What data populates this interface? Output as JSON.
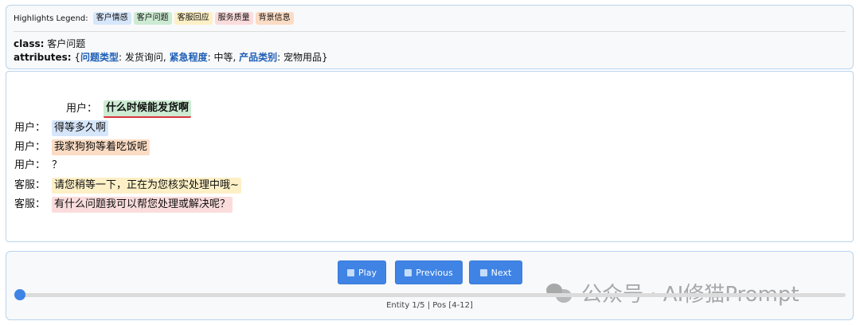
{
  "legend": {
    "title": "Highlights Legend:",
    "tags": [
      {
        "label": "客户情感",
        "color": "#d6e6fa"
      },
      {
        "label": "客户问题",
        "color": "#cdebd3"
      },
      {
        "label": "客服回应",
        "color": "#fdf0c6"
      },
      {
        "label": "服务质量",
        "color": "#fbdcdc"
      },
      {
        "label": "背景信息",
        "color": "#fbdcc4"
      }
    ]
  },
  "meta": {
    "class_key": "class:",
    "class_value": "客户问题",
    "attrs_key": "attributes:",
    "attrs_open": "{",
    "attrs_close": "}",
    "attrs": [
      {
        "key": "问题类型",
        "value": "发货询问"
      },
      {
        "key": "紧急程度",
        "value": "中等"
      },
      {
        "key": "产品类别",
        "value": "宠物用品"
      }
    ]
  },
  "dialog": [
    {
      "speaker": "用户：",
      "text": "什么时候能发货啊",
      "color": "#cdebd3",
      "active": true
    },
    {
      "speaker": "用户：",
      "text": "得等多久啊",
      "color": "#d6e6fa"
    },
    {
      "speaker": "用户：",
      "text": "我家狗狗等着吃饭呢",
      "color": "#fbdcc4"
    },
    {
      "speaker": "用户：",
      "text": "？",
      "color": ""
    },
    {
      "speaker": "客服：",
      "text": "请您稍等一下，正在为您核实处理中哦~",
      "color": "#fdf0c6"
    },
    {
      "speaker": "客服：",
      "text": "有什么问题我可以帮您处理或解决呢？",
      "color": "#fbdcdc"
    }
  ],
  "player": {
    "play_label": "Play",
    "prev_label": "Previous",
    "next_label": "Next",
    "status": "Entity 1/5 | Pos [4-12]",
    "progress": 0
  },
  "watermark": "公众号 · AI修猫Prompt",
  "colors": {
    "accent": "#3f84e5",
    "border": "#b9d4ec",
    "key": "#1f5fb5",
    "underline": "#d9343f"
  }
}
